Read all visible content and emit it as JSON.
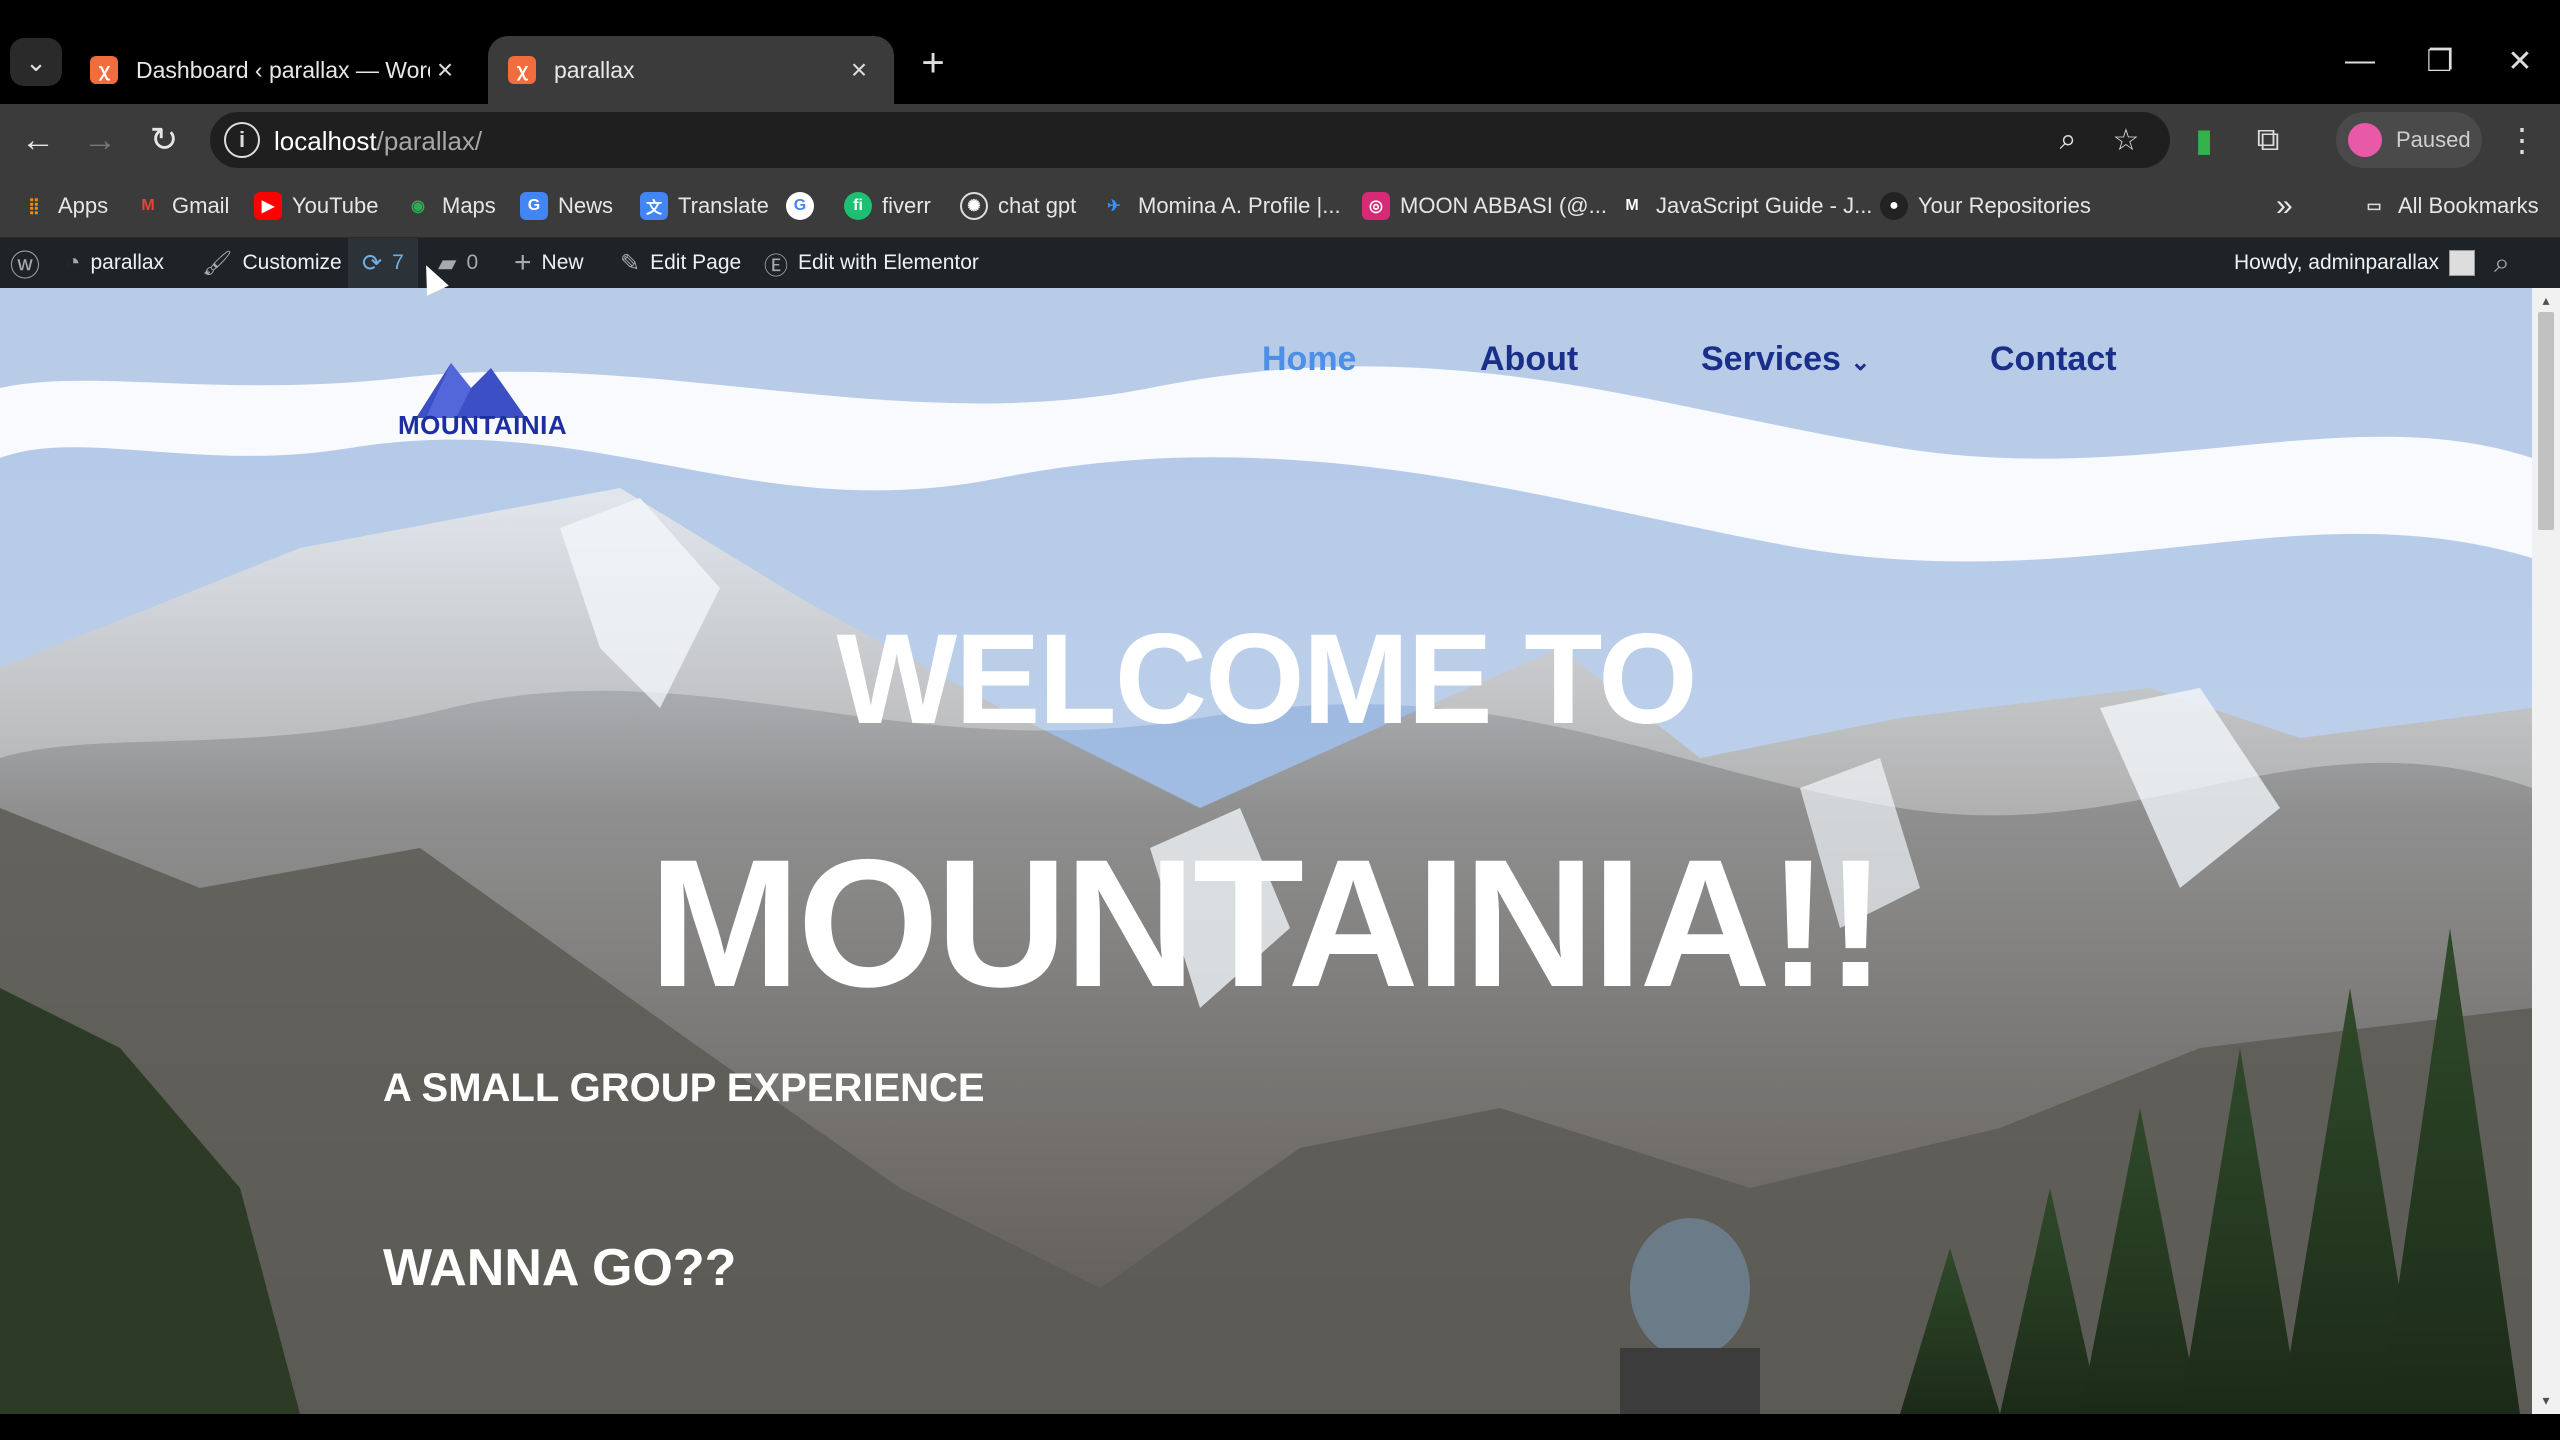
{
  "browser": {
    "tabs": [
      {
        "title": "Dashboard ‹ parallax — WordPr",
        "active": false
      },
      {
        "title": "parallax",
        "active": true
      }
    ],
    "url_host": "localhost",
    "url_path": "/parallax/",
    "profile_status": "Paused"
  },
  "bookmarks": {
    "items": [
      "Apps",
      "Gmail",
      "YouTube",
      "Maps",
      "News",
      "Translate",
      "",
      "fiverr",
      "chat gpt",
      "Momina A. Profile |...",
      "MOON ABBASI (@...",
      "JavaScript Guide - J...",
      "Your Repositories"
    ],
    "overflow": "»",
    "all_bookmarks": "All Bookmarks"
  },
  "wp_admin_bar": {
    "site_name": "parallax",
    "customize": "Customize",
    "updates_count": "7",
    "comments_count": "0",
    "new": "New",
    "edit_page": "Edit Page",
    "edit_elementor": "Edit with Elementor",
    "howdy": "Howdy, adminparallax"
  },
  "site": {
    "logo_text": "MOUNTAINIA",
    "nav": [
      {
        "label": "Home",
        "active": true
      },
      {
        "label": "About",
        "active": false
      },
      {
        "label": "Services",
        "active": false
      },
      {
        "label": "Contact",
        "active": false
      }
    ],
    "hero_line1": "WELCOME TO",
    "hero_line2": "MOUNTAINIA!!",
    "tagline": "A SMALL GROUP EXPERIENCE",
    "cta_text": "WANNA GO??"
  },
  "colors": {
    "nav_active": "#4d8ee6",
    "nav": "#1a2f8a",
    "wp_bar": "#1d2327",
    "chrome_bg": "#3b3b3b"
  }
}
